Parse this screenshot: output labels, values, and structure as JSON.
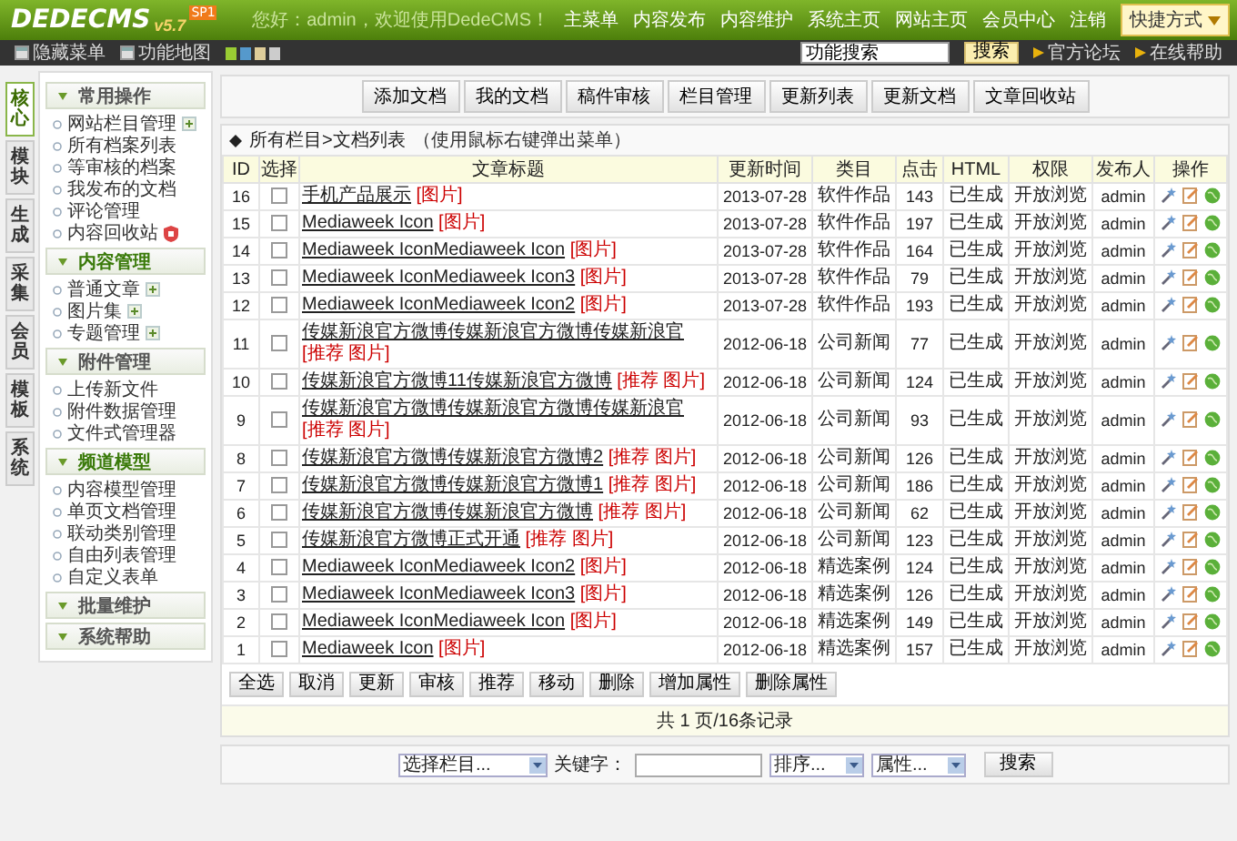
{
  "header": {
    "logo": "DEDECMS",
    "version": "v5.7",
    "badge": "SP1",
    "greeting": "您好：admin，欢迎使用DedeCMS！",
    "nav": [
      "主菜单",
      "内容发布",
      "内容维护",
      "系统主页",
      "网站主页",
      "会员中心",
      "注销"
    ],
    "shortcut": "快捷方式"
  },
  "subbar": {
    "links": [
      "隐藏菜单",
      "功能地图"
    ],
    "search": {
      "value": "功能搜索"
    },
    "search_button": "搜索",
    "right_links": [
      "官方论坛",
      "在线帮助"
    ]
  },
  "side_tabs": [
    {
      "label": "核心",
      "selected": true
    },
    {
      "label": "模块",
      "selected": false
    },
    {
      "label": "生成",
      "selected": false
    },
    {
      "label": "采集",
      "selected": false
    },
    {
      "label": "会员",
      "selected": false
    },
    {
      "label": "模板",
      "selected": false
    },
    {
      "label": "系统",
      "selected": false
    }
  ],
  "menu_groups": [
    {
      "title": "常用操作",
      "items": [
        {
          "label": "网站栏目管理",
          "kind": "add"
        },
        {
          "label": "所有档案列表",
          "kind": "plain"
        },
        {
          "label": "等审核的档案",
          "kind": "plain"
        },
        {
          "label": "我发布的文档",
          "kind": "plain"
        },
        {
          "label": "评论管理",
          "kind": "plain"
        },
        {
          "label": "内容回收站",
          "kind": "trash"
        }
      ]
    },
    {
      "title": "内容管理",
      "items": [
        {
          "label": "普通文章",
          "kind": "add"
        },
        {
          "label": "图片集",
          "kind": "add"
        },
        {
          "label": "专题管理",
          "kind": "add"
        }
      ]
    },
    {
      "title": "附件管理",
      "items": [
        {
          "label": "上传新文件",
          "kind": "plain"
        },
        {
          "label": "附件数据管理",
          "kind": "plain"
        },
        {
          "label": "文件式管理器",
          "kind": "plain"
        }
      ]
    },
    {
      "title": "频道模型",
      "items": [
        {
          "label": "内容模型管理",
          "kind": "plain"
        },
        {
          "label": "单页文档管理",
          "kind": "plain"
        },
        {
          "label": "联动类别管理",
          "kind": "plain"
        },
        {
          "label": "自由列表管理",
          "kind": "plain"
        },
        {
          "label": "自定义表单",
          "kind": "plain"
        }
      ]
    },
    {
      "title": "批量维护"
    },
    {
      "title": "系统帮助"
    }
  ],
  "toolbar": [
    "添加文档",
    "我的文档",
    "稿件审核",
    "栏目管理",
    "更新列表",
    "更新文档",
    "文章回收站"
  ],
  "list_heading": {
    "path": "所有栏目>文档列表",
    "hint": "（使用鼠标右键弹出菜单）"
  },
  "table": {
    "columns": [
      "ID",
      "选择",
      "文章标题",
      "更新时间",
      "类目",
      "点击",
      "HTML",
      "权限",
      "发布人",
      "操作"
    ],
    "rows": [
      {
        "id": "16",
        "selected": false,
        "title": "手机产品展示",
        "flags": "[图片]",
        "date": "2013-07-28",
        "category": "软件作品",
        "clicks": "143",
        "html": "已生成",
        "access": "开放浏览",
        "author": "admin"
      },
      {
        "id": "15",
        "selected": false,
        "title": "Mediaweek Icon",
        "flags": "[图片]",
        "date": "2013-07-28",
        "category": "软件作品",
        "clicks": "197",
        "html": "已生成",
        "access": "开放浏览",
        "author": "admin"
      },
      {
        "id": "14",
        "selected": false,
        "title": "Mediaweek IconMediaweek Icon",
        "flags": "[图片]",
        "date": "2013-07-28",
        "category": "软件作品",
        "clicks": "164",
        "html": "已生成",
        "access": "开放浏览",
        "author": "admin"
      },
      {
        "id": "13",
        "selected": false,
        "title": "Mediaweek IconMediaweek Icon3",
        "flags": "[图片]",
        "date": "2013-07-28",
        "category": "软件作品",
        "clicks": "79",
        "html": "已生成",
        "access": "开放浏览",
        "author": "admin"
      },
      {
        "id": "12",
        "selected": false,
        "title": "Mediaweek IconMediaweek Icon2",
        "flags": "[图片]",
        "date": "2013-07-28",
        "category": "软件作品",
        "clicks": "193",
        "html": "已生成",
        "access": "开放浏览",
        "author": "admin"
      },
      {
        "id": "11",
        "selected": false,
        "title": "传媒新浪官方微博传媒新浪官方微博传媒新浪官",
        "flags": "[推荐 图片]",
        "date": "2012-06-18",
        "category": "公司新闻",
        "clicks": "77",
        "html": "已生成",
        "access": "开放浏览",
        "author": "admin"
      },
      {
        "id": "10",
        "selected": false,
        "title": "传媒新浪官方微博11传媒新浪官方微博",
        "flags": "[推荐 图片]",
        "date": "2012-06-18",
        "category": "公司新闻",
        "clicks": "124",
        "html": "已生成",
        "access": "开放浏览",
        "author": "admin"
      },
      {
        "id": "9",
        "selected": false,
        "title": "传媒新浪官方微博传媒新浪官方微博传媒新浪官",
        "flags": "[推荐 图片]",
        "date": "2012-06-18",
        "category": "公司新闻",
        "clicks": "93",
        "html": "已生成",
        "access": "开放浏览",
        "author": "admin"
      },
      {
        "id": "8",
        "selected": false,
        "title": "传媒新浪官方微博传媒新浪官方微博2",
        "flags": "[推荐 图片]",
        "date": "2012-06-18",
        "category": "公司新闻",
        "clicks": "126",
        "html": "已生成",
        "access": "开放浏览",
        "author": "admin"
      },
      {
        "id": "7",
        "selected": false,
        "title": "传媒新浪官方微博传媒新浪官方微博1",
        "flags": "[推荐 图片]",
        "date": "2012-06-18",
        "category": "公司新闻",
        "clicks": "186",
        "html": "已生成",
        "access": "开放浏览",
        "author": "admin"
      },
      {
        "id": "6",
        "selected": false,
        "title": "传媒新浪官方微博传媒新浪官方微博",
        "flags": "[推荐 图片]",
        "date": "2012-06-18",
        "category": "公司新闻",
        "clicks": "62",
        "html": "已生成",
        "access": "开放浏览",
        "author": "admin"
      },
      {
        "id": "5",
        "selected": false,
        "title": "传媒新浪官方微博正式开通",
        "flags": "[推荐 图片]",
        "date": "2012-06-18",
        "category": "公司新闻",
        "clicks": "123",
        "html": "已生成",
        "access": "开放浏览",
        "author": "admin"
      },
      {
        "id": "4",
        "selected": false,
        "title": "Mediaweek IconMediaweek Icon2",
        "flags": "[图片]",
        "date": "2012-06-18",
        "category": "精选案例",
        "clicks": "124",
        "html": "已生成",
        "access": "开放浏览",
        "author": "admin"
      },
      {
        "id": "3",
        "selected": false,
        "title": "Mediaweek IconMediaweek Icon3",
        "flags": "[图片]",
        "date": "2012-06-18",
        "category": "精选案例",
        "clicks": "126",
        "html": "已生成",
        "access": "开放浏览",
        "author": "admin"
      },
      {
        "id": "2",
        "selected": false,
        "title": "Mediaweek IconMediaweek Icon",
        "flags": "[图片]",
        "date": "2012-06-18",
        "category": "精选案例",
        "clicks": "149",
        "html": "已生成",
        "access": "开放浏览",
        "author": "admin"
      },
      {
        "id": "1",
        "selected": false,
        "title": "Mediaweek Icon",
        "flags": "[图片]",
        "date": "2012-06-18",
        "category": "精选案例",
        "clicks": "157",
        "html": "已生成",
        "access": "开放浏览",
        "author": "admin"
      }
    ]
  },
  "actions": [
    "全选",
    "取消",
    "更新",
    "审核",
    "推荐",
    "移动",
    "删除",
    "增加属性",
    "删除属性"
  ],
  "pager": "共 1 页/16条记录",
  "filter": {
    "category": "选择栏目...",
    "keyword_label": "关键字：",
    "order": "排序...",
    "attribute": "属性...",
    "button": "搜索"
  }
}
